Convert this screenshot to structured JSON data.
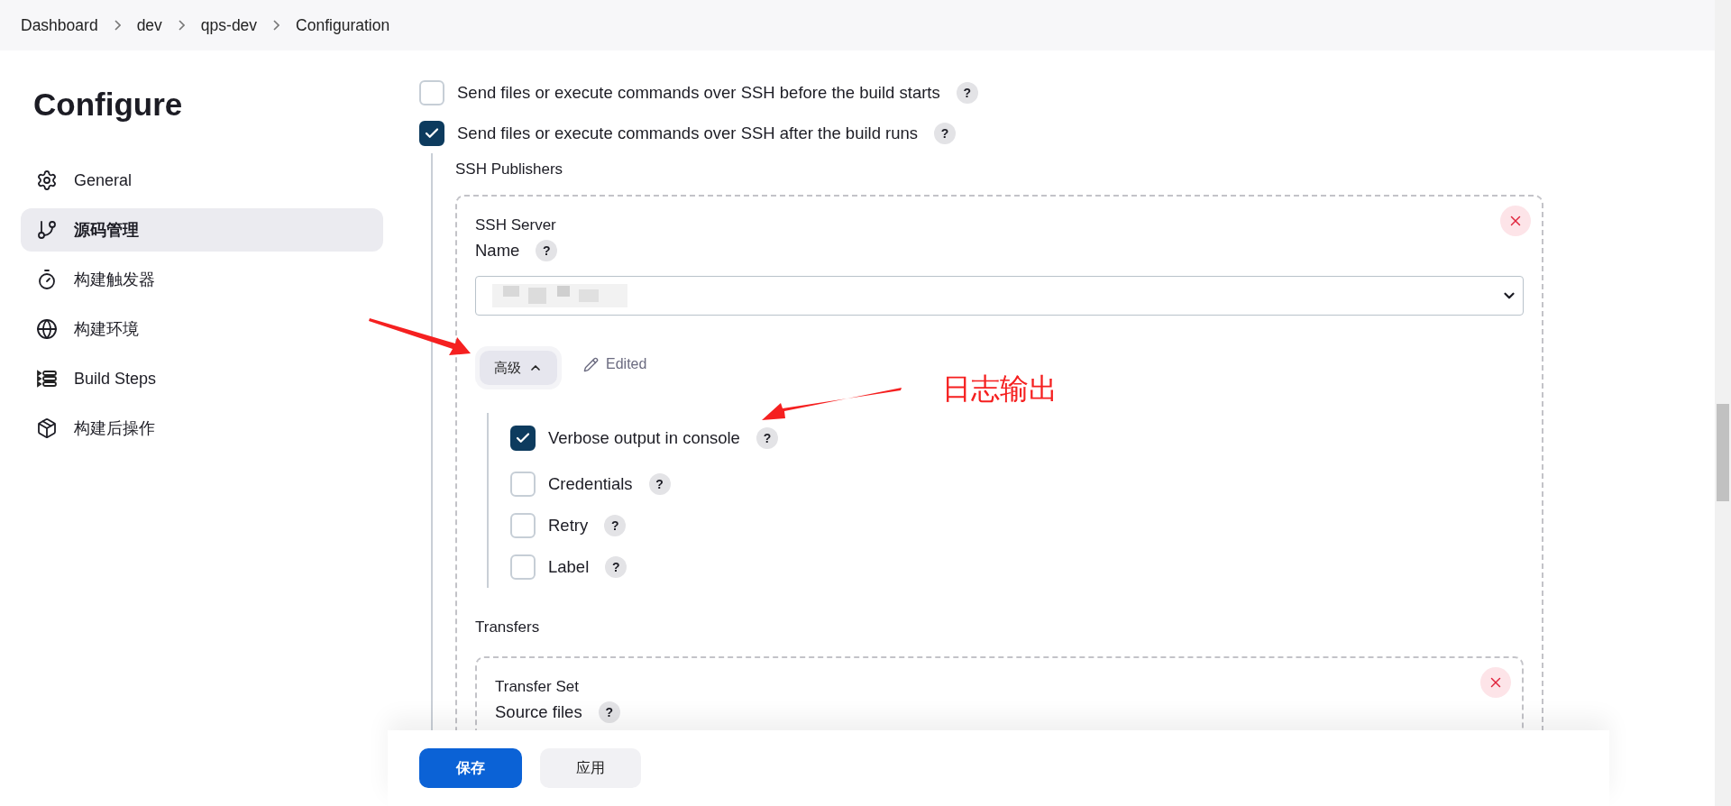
{
  "breadcrumbs": [
    "Dashboard",
    "dev",
    "qps-dev",
    "Configuration"
  ],
  "sidebar": {
    "title": "Configure",
    "items": [
      {
        "label": "General",
        "selected": false
      },
      {
        "label": "源码管理",
        "selected": true
      },
      {
        "label": "构建触发器",
        "selected": false
      },
      {
        "label": "构建环境",
        "selected": false
      },
      {
        "label": "Build Steps",
        "selected": false
      },
      {
        "label": "构建后操作",
        "selected": false
      }
    ]
  },
  "options": [
    {
      "label": "Send files or execute commands over SSH before the build starts",
      "help": "?",
      "checked": false
    },
    {
      "label": "Send files or execute commands over SSH after the build runs",
      "help": "?",
      "checked": true
    }
  ],
  "ssh_publishers": {
    "label": "SSH Publishers",
    "server": {
      "title": "SSH Server",
      "name_label": "Name",
      "name_help": "?",
      "advanced_button": "高级",
      "expanded": true,
      "edited_label": "Edited",
      "advanced_options": [
        {
          "label": "Verbose output in console",
          "help": "?",
          "checked": true
        },
        {
          "label": "Credentials",
          "help": "?",
          "checked": false
        },
        {
          "label": "Retry",
          "help": "?",
          "checked": false
        },
        {
          "label": "Label",
          "help": "?",
          "checked": false
        }
      ]
    },
    "transfers": {
      "label": "Transfers",
      "set_title": "Transfer Set",
      "source_files_label": "Source files",
      "source_files_help": "?"
    }
  },
  "annotation": {
    "text": "日志输出"
  },
  "footer": {
    "save": "保存",
    "apply": "应用"
  }
}
